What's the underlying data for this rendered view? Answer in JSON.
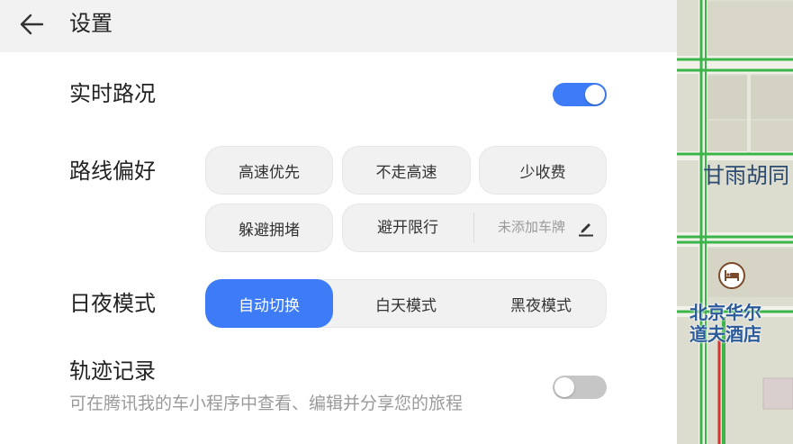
{
  "header": {
    "title": "设置"
  },
  "traffic": {
    "label": "实时路况",
    "enabled": true
  },
  "route_pref": {
    "label": "路线偏好",
    "options": [
      "高速优先",
      "不走高速",
      "少收费",
      "躲避拥堵",
      "避开限行"
    ],
    "plate_placeholder": "未添加车牌"
  },
  "day_night": {
    "label": "日夜模式",
    "options": [
      "自动切换",
      "白天模式",
      "黑夜模式"
    ],
    "selected": "自动切换"
  },
  "track": {
    "label": "轨迹记录",
    "description": "可在腾讯我的车小程序中查看、编辑并分享您的旅程",
    "enabled": false
  },
  "map": {
    "street_label": "甘雨胡同",
    "poi_name_line1": "北京华尔",
    "poi_name_line2": "道夫酒店",
    "poi_icon": "hotel-icon"
  },
  "colors": {
    "accent": "#3d7cf6",
    "road_green": "#3bb54a",
    "road_red": "#d93030",
    "poi_brown": "#7a4a2a"
  }
}
